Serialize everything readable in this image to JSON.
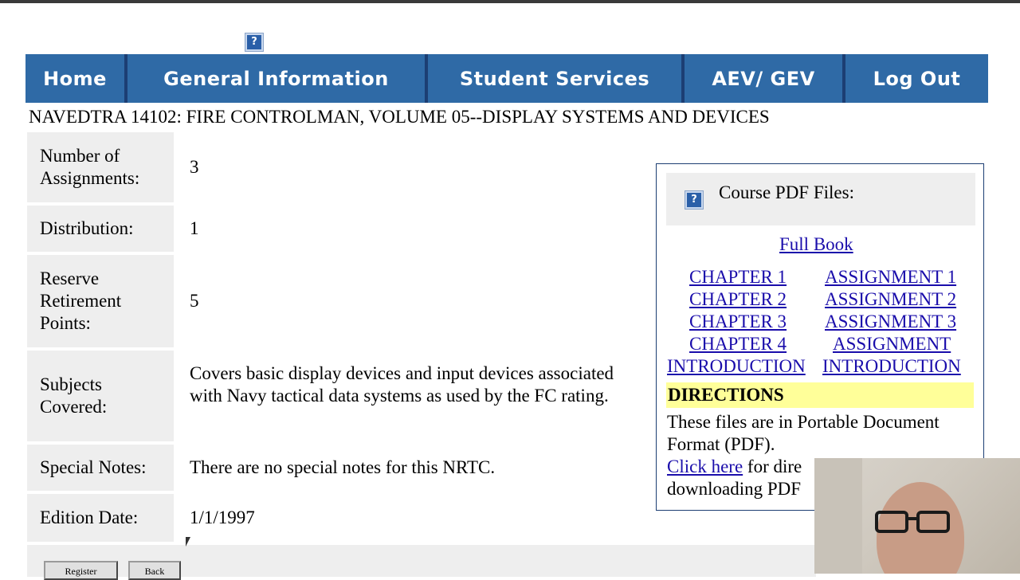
{
  "help_icon_label": "?",
  "nav": {
    "items": [
      "Home",
      "General Information",
      "Student Services",
      "AEV/ GEV",
      "Log Out"
    ]
  },
  "course_title": "NAVEDTRA 14102: FIRE CONTROLMAN, VOLUME 05--DISPLAY SYSTEMS AND DEVICES",
  "course_info": [
    {
      "label": "Number of Assignments:",
      "value": "3"
    },
    {
      "label": "Distribution:",
      "value": "1"
    },
    {
      "label": "Reserve Retirement Points:",
      "value": "5"
    },
    {
      "label": "Subjects Covered:",
      "value": "Covers basic display devices and input devices associated with Navy tactical data systems as used by the FC rating."
    },
    {
      "label": "Special Notes:",
      "value": "There are no special notes for this NRTC."
    },
    {
      "label": "Edition Date:",
      "value": "1/1/1997"
    }
  ],
  "buttons": {
    "register": "Register",
    "back": "Back"
  },
  "pdf_panel": {
    "title": "Course PDF Files:",
    "full_book": "Full Book",
    "chapters": [
      "CHAPTER 1",
      "CHAPTER 2",
      "CHAPTER 3",
      "CHAPTER 4"
    ],
    "assignments": [
      "ASSIGNMENT 1",
      "ASSIGNMENT 2",
      "ASSIGNMENT 3",
      "ASSIGNMENT"
    ],
    "introduction_left": "INTRODUCTION",
    "introduction_right": "INTRODUCTION",
    "directions_heading": "DIRECTIONS",
    "directions_text": "These files are in Portable Document Format (PDF).",
    "click_here": "Click here",
    "click_here_suffix": " for dire",
    "downloading_text": "downloading PDF"
  },
  "colors": {
    "nav_bg": "#2f6aa6",
    "nav_divider": "#1c3e73",
    "label_bg": "#eeeeee",
    "directions_bg": "#ffff99",
    "link": "#1a0dab"
  }
}
